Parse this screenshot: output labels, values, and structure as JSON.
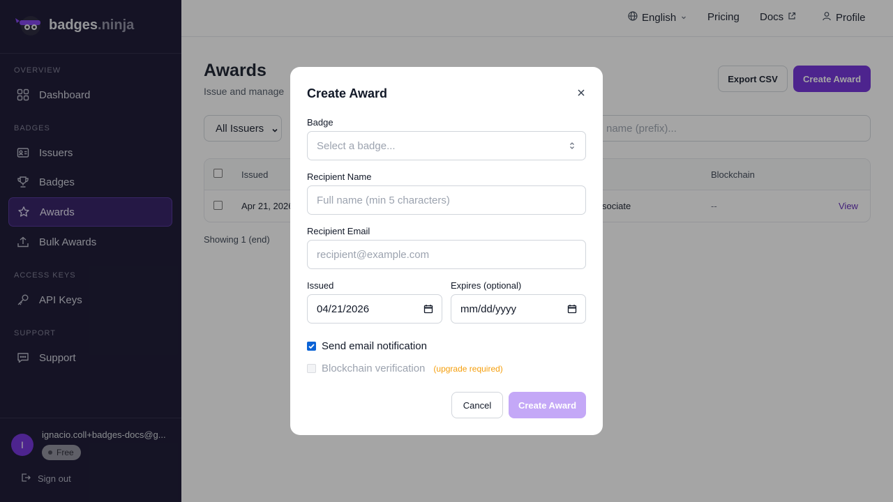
{
  "brand": {
    "name_part1": "badges",
    "name_part2": ".ninja"
  },
  "sidebar": {
    "sections": [
      {
        "title": "OVERVIEW",
        "items": [
          {
            "label": "Dashboard",
            "icon": "grid-icon"
          }
        ]
      },
      {
        "title": "BADGES",
        "items": [
          {
            "label": "Issuers",
            "icon": "id-card-icon"
          },
          {
            "label": "Badges",
            "icon": "trophy-icon"
          },
          {
            "label": "Awards",
            "icon": "star-icon",
            "active": true
          },
          {
            "label": "Bulk Awards",
            "icon": "upload-icon"
          }
        ]
      },
      {
        "title": "ACCESS KEYS",
        "items": [
          {
            "label": "API Keys",
            "icon": "key-icon"
          }
        ]
      },
      {
        "title": "SUPPORT",
        "items": [
          {
            "label": "Support",
            "icon": "chat-icon"
          }
        ]
      }
    ],
    "user": {
      "initial": "I",
      "email": "ignacio.coll+badges-docs@g...",
      "plan": "Free"
    },
    "signout": "Sign out"
  },
  "topbar": {
    "language": "English",
    "pricing": "Pricing",
    "docs": "Docs",
    "profile": "Profile"
  },
  "main": {
    "title": "Awards",
    "subtitle": "Issue and manage",
    "export_label": "Export CSV",
    "create_label": "Create Award",
    "filter_value": "All Issuers",
    "search_placeholder": "name (prefix)...",
    "table": {
      "headers": {
        "issued": "Issued",
        "blockchain": "Blockchain"
      },
      "row": {
        "issued": "Apr 21, 2026",
        "badge_fragment": "sociate",
        "blockchain": "--",
        "action": "View"
      }
    },
    "showing": "Showing 1 (end)"
  },
  "modal": {
    "title": "Create Award",
    "badge_label": "Badge",
    "badge_placeholder": "Select a badge...",
    "name_label": "Recipient Name",
    "name_placeholder": "Full name (min 5 characters)",
    "email_label": "Recipient Email",
    "email_placeholder": "recipient@example.com",
    "issued_label": "Issued",
    "issued_value": "04/21/2026",
    "expires_label": "Expires (optional)",
    "expires_placeholder": "mm/dd/yyyy",
    "send_email_label": "Send email notification",
    "send_email_checked": true,
    "blockchain_label": "Blockchain verification",
    "blockchain_checked": false,
    "upgrade_note": "(upgrade required)",
    "cancel_label": "Cancel",
    "submit_label": "Create Award"
  },
  "colors": {
    "accent": "#6d28d9",
    "sidebar_bg": "#0f0d2a",
    "submit_disabled": "#c4a8f7",
    "upgrade": "#f59e0b"
  }
}
